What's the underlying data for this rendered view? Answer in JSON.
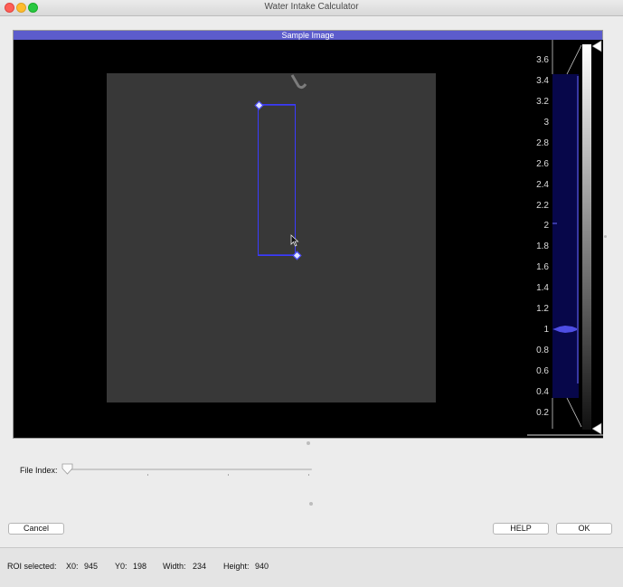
{
  "window": {
    "title": "Water Intake Calculator"
  },
  "panel": {
    "title": "Sample Image"
  },
  "colorbar": {
    "ticks": [
      "3.6",
      "3.4",
      "3.2",
      "3",
      "2.8",
      "2.6",
      "2.4",
      "2.2",
      "2",
      "1.8",
      "1.6",
      "1.4",
      "1.2",
      "1",
      "0.8",
      "0.6",
      "0.4",
      "0.2"
    ]
  },
  "controls": {
    "file_index_label": "File Index:",
    "cancel_label": "Cancel",
    "help_label": "HELP",
    "ok_label": "OK"
  },
  "status": {
    "roi_label": "ROI selected:",
    "x0_label": "X0:",
    "x0_value": "945",
    "y0_label": "Y0:",
    "y0_value": "198",
    "width_label": "Width:",
    "width_value": "234",
    "height_label": "Height:",
    "height_value": "940"
  },
  "colors": {
    "accent": "#5c5ccc",
    "roi": "#3b3bff"
  }
}
